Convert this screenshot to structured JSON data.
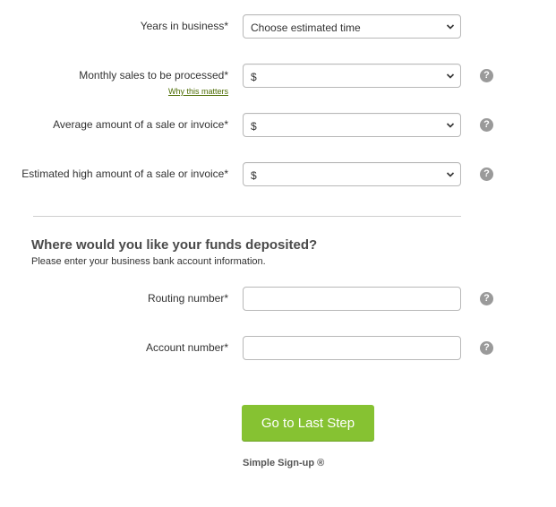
{
  "business_fields": [
    {
      "label": "Years in business*",
      "value": "Choose estimated time",
      "help": false
    },
    {
      "label": "Monthly sales to be processed*",
      "value": "$",
      "help": true,
      "sublink": "Why this matters"
    },
    {
      "label": "Average amount of a sale or invoice*",
      "value": "$",
      "help": true
    },
    {
      "label": "Estimated high amount of a sale or invoice*",
      "value": "$",
      "help": true
    }
  ],
  "deposit": {
    "title": "Where would you like your funds deposited?",
    "subtitle": "Please enter your business bank account information.",
    "routing_label": "Routing number*",
    "routing_value": "",
    "account_label": "Account number*",
    "account_value": ""
  },
  "help_glyph": "?",
  "cta_label": "Go to Last Step",
  "footer_note": "Simple Sign-up ®",
  "colors": {
    "cta_green": "#86c232",
    "help_gray": "#9a9a9a",
    "link_green": "#4b6b00"
  }
}
